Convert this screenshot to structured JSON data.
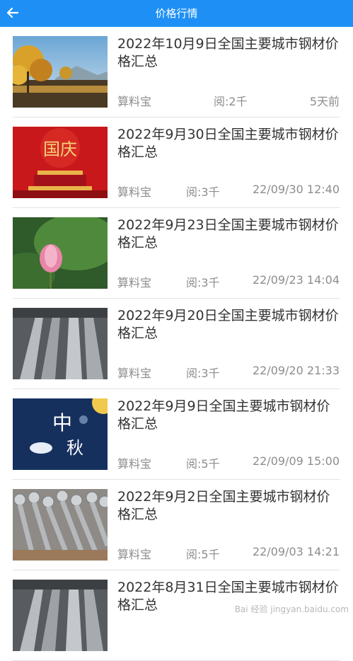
{
  "header": {
    "title": "价格行情",
    "back_icon": "arrow-left-icon",
    "bg_color": "#1e90f5"
  },
  "articles": [
    {
      "title": "2022年10月9日全国主要城市钢材价格汇总",
      "author": "算料宝",
      "reads": "阅:2千",
      "time": "5天前",
      "thumb": "autumn-landscape"
    },
    {
      "title": "2022年9月30日全国主要城市钢材价格汇总",
      "author": "算料宝",
      "reads": "阅:3千",
      "time": "22/09/30 12:40",
      "thumb": "national-day"
    },
    {
      "title": "2022年9月23日全国主要城市钢材价格汇总",
      "author": "算料宝",
      "reads": "阅:3千",
      "time": "22/09/23 14:04",
      "thumb": "lotus"
    },
    {
      "title": "2022年9月20日全国主要城市钢材价格汇总",
      "author": "算料宝",
      "reads": "阅:3千",
      "time": "22/09/20 21:33",
      "thumb": "steel-beams"
    },
    {
      "title": "2022年9月9日全国主要城市钢材价格汇总",
      "author": "算料宝",
      "reads": "阅:5千",
      "time": "22/09/09 15:00",
      "thumb": "mid-autumn"
    },
    {
      "title": "2022年9月2日全国主要城市钢材价格汇总",
      "author": "算料宝",
      "reads": "阅:5千",
      "time": "22/09/03 14:21",
      "thumb": "steel-pipes"
    },
    {
      "title": "2022年8月31日全国主要城市钢材价格汇总",
      "author": "",
      "reads": "",
      "time": "",
      "thumb": "steel-beams"
    }
  ],
  "watermark": "Bai 经验 jingyan.baidu.com"
}
